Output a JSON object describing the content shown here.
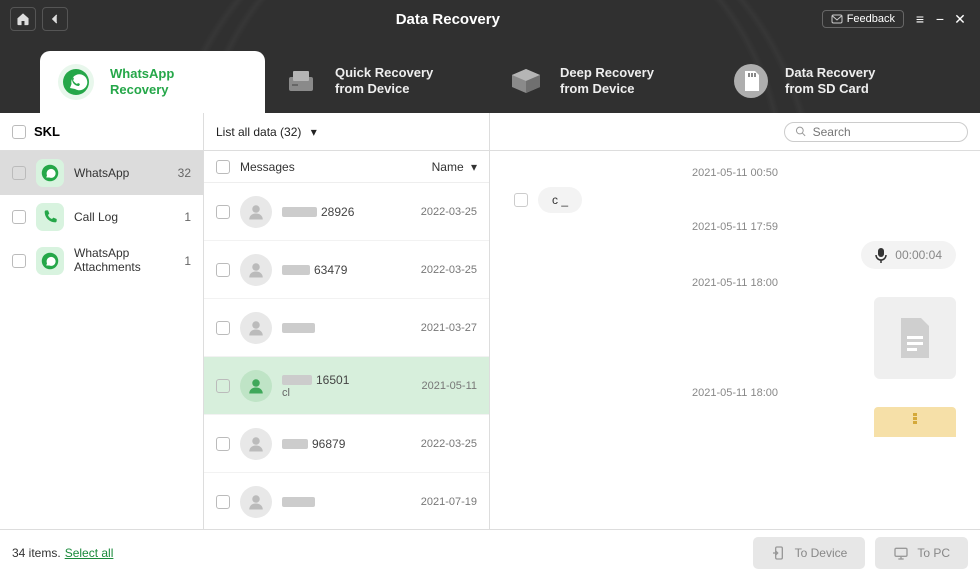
{
  "app": {
    "title": "Data Recovery",
    "feedback": "Feedback"
  },
  "tabs": [
    {
      "title": "WhatsApp\nRecovery"
    },
    {
      "title": "Quick Recovery\nfrom Device"
    },
    {
      "title": "Deep Recovery\nfrom Device"
    },
    {
      "title": "Data Recovery\nfrom SD Card"
    }
  ],
  "device": {
    "name": "SKL"
  },
  "filter": {
    "label": "List all data",
    "count": "(32)"
  },
  "search": {
    "placeholder": "Search"
  },
  "sidebar": [
    {
      "label": "WhatsApp",
      "count": "32",
      "selected": true
    },
    {
      "label": "Call Log",
      "count": "1",
      "selected": false
    },
    {
      "label": "WhatsApp Attachments",
      "count": "1",
      "selected": false
    }
  ],
  "messages": {
    "header": {
      "col1": "Messages",
      "col2": "Name"
    },
    "items": [
      {
        "name": "28926",
        "date": "2022-03-25"
      },
      {
        "name": "63479",
        "date": "2022-03-25"
      },
      {
        "name": "",
        "date": "2021-03-27"
      },
      {
        "name": "16501",
        "sub": "cl",
        "date": "2021-05-11",
        "selected": true
      },
      {
        "name": "96879",
        "date": "2022-03-25"
      },
      {
        "name": "",
        "date": "2021-07-19"
      }
    ]
  },
  "chat": {
    "ts1": "2021-05-11 00:50",
    "bubble1": "c _",
    "ts2": "2021-05-11 17:59",
    "voice_duration": "00:00:04",
    "ts3": "2021-05-11 18:00",
    "ts4": "2021-05-11 18:00"
  },
  "footer": {
    "items_text": "34 items.",
    "select_all": "Select all",
    "to_device": "To Device",
    "to_pc": "To PC"
  }
}
